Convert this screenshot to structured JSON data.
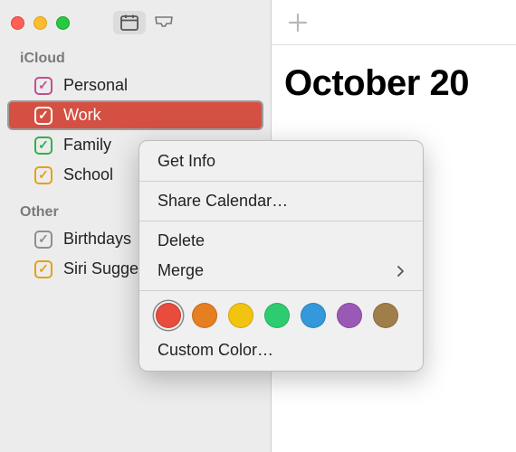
{
  "titlebar": {
    "close": "close",
    "minimize": "minimize",
    "zoom": "zoom"
  },
  "sidebar": {
    "sections": [
      {
        "title": "iCloud",
        "items": [
          {
            "label": "Personal",
            "color": "#c74d8e",
            "checked": true,
            "selected": false
          },
          {
            "label": "Work",
            "color": "#c9382d",
            "checked": true,
            "selected": true
          },
          {
            "label": "Family",
            "color": "#2fb24a",
            "checked": true,
            "selected": false
          },
          {
            "label": "School",
            "color": "#e6a113",
            "checked": true,
            "selected": false
          }
        ]
      },
      {
        "title": "Other",
        "items": [
          {
            "label": "Birthdays",
            "color": "#8e8e93",
            "checked": true,
            "selected": false
          },
          {
            "label": "Siri Suggestions",
            "color": "#e6a113",
            "checked": true,
            "selected": false
          }
        ]
      }
    ]
  },
  "main": {
    "month_title": "October 20"
  },
  "context_menu": {
    "get_info": "Get Info",
    "share": "Share Calendar…",
    "delete": "Delete",
    "merge": "Merge",
    "custom_color": "Custom Color…",
    "colors": [
      {
        "hex": "#e74c3c",
        "selected": true
      },
      {
        "hex": "#e67e22",
        "selected": false
      },
      {
        "hex": "#f1c40f",
        "selected": false
      },
      {
        "hex": "#2ecc71",
        "selected": false
      },
      {
        "hex": "#3498db",
        "selected": false
      },
      {
        "hex": "#9b59b6",
        "selected": false
      },
      {
        "hex": "#a07e4a",
        "selected": false
      }
    ]
  }
}
